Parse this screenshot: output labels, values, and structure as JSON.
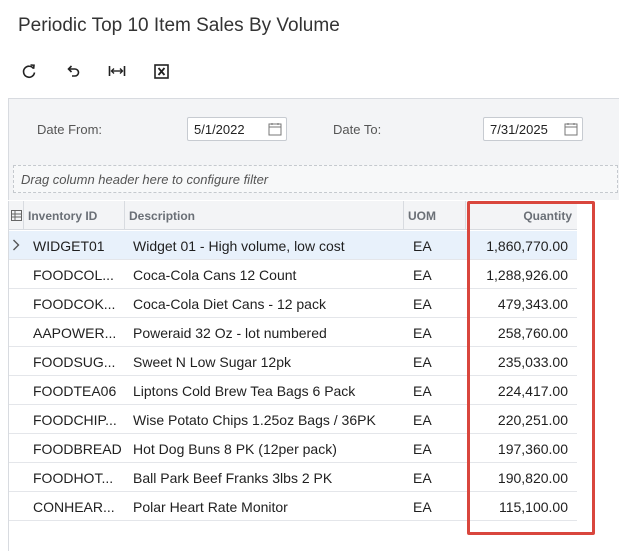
{
  "page": {
    "title": "Periodic Top 10 Item Sales By Volume"
  },
  "toolbar": {
    "buttons": [
      {
        "name": "refresh-button",
        "icon": "refresh-icon"
      },
      {
        "name": "undo-button",
        "icon": "undo-icon"
      },
      {
        "name": "fit-to-screen-button",
        "icon": "fit-columns-icon"
      },
      {
        "name": "export-excel-button",
        "icon": "excel-icon"
      }
    ]
  },
  "filters": {
    "date_from_label": "Date From:",
    "date_from_value": "5/1/2022",
    "date_to_label": "Date To:",
    "date_to_value": "7/31/2025"
  },
  "group_area": {
    "placeholder": "Drag column header here to configure filter"
  },
  "grid": {
    "columns": {
      "inventory_id": "Inventory ID",
      "description": "Description",
      "uom": "UOM",
      "quantity": "Quantity"
    },
    "rows": [
      {
        "inventory_id": "WIDGET01",
        "description": "Widget 01 - High volume, low cost",
        "uom": "EA",
        "quantity": "1,860,770.00"
      },
      {
        "inventory_id": "FOODCOL...",
        "description": "Coca-Cola Cans 12 Count",
        "uom": "EA",
        "quantity": "1,288,926.00"
      },
      {
        "inventory_id": "FOODCOK...",
        "description": "Coca-Cola Diet Cans - 12 pack",
        "uom": "EA",
        "quantity": "479,343.00"
      },
      {
        "inventory_id": "AAPOWER...",
        "description": "Poweraid 32 Oz - lot numbered",
        "uom": "EA",
        "quantity": "258,760.00"
      },
      {
        "inventory_id": "FOODSUG...",
        "description": "Sweet N Low Sugar 12pk",
        "uom": "EA",
        "quantity": "235,033.00"
      },
      {
        "inventory_id": "FOODTEA06",
        "description": "Liptons Cold Brew Tea Bags 6 Pack",
        "uom": "EA",
        "quantity": "224,417.00"
      },
      {
        "inventory_id": "FOODCHIP...",
        "description": "Wise Potato Chips 1.25oz Bags / 36PK",
        "uom": "EA",
        "quantity": "220,251.00"
      },
      {
        "inventory_id": "FOODBREAD",
        "description": "Hot Dog Buns 8 PK (12per pack)",
        "uom": "EA",
        "quantity": "197,360.00"
      },
      {
        "inventory_id": "FOODHOT...",
        "description": "Ball Park Beef Franks 3lbs 2 PK",
        "uom": "EA",
        "quantity": "190,820.00"
      },
      {
        "inventory_id": "CONHEAR...",
        "description": "Polar Heart Rate Monitor",
        "uom": "EA",
        "quantity": "115,100.00"
      }
    ]
  },
  "colors": {
    "highlight": "#d9463d",
    "selected_row": "#e8f1fb",
    "panel": "#f3f4f6"
  }
}
